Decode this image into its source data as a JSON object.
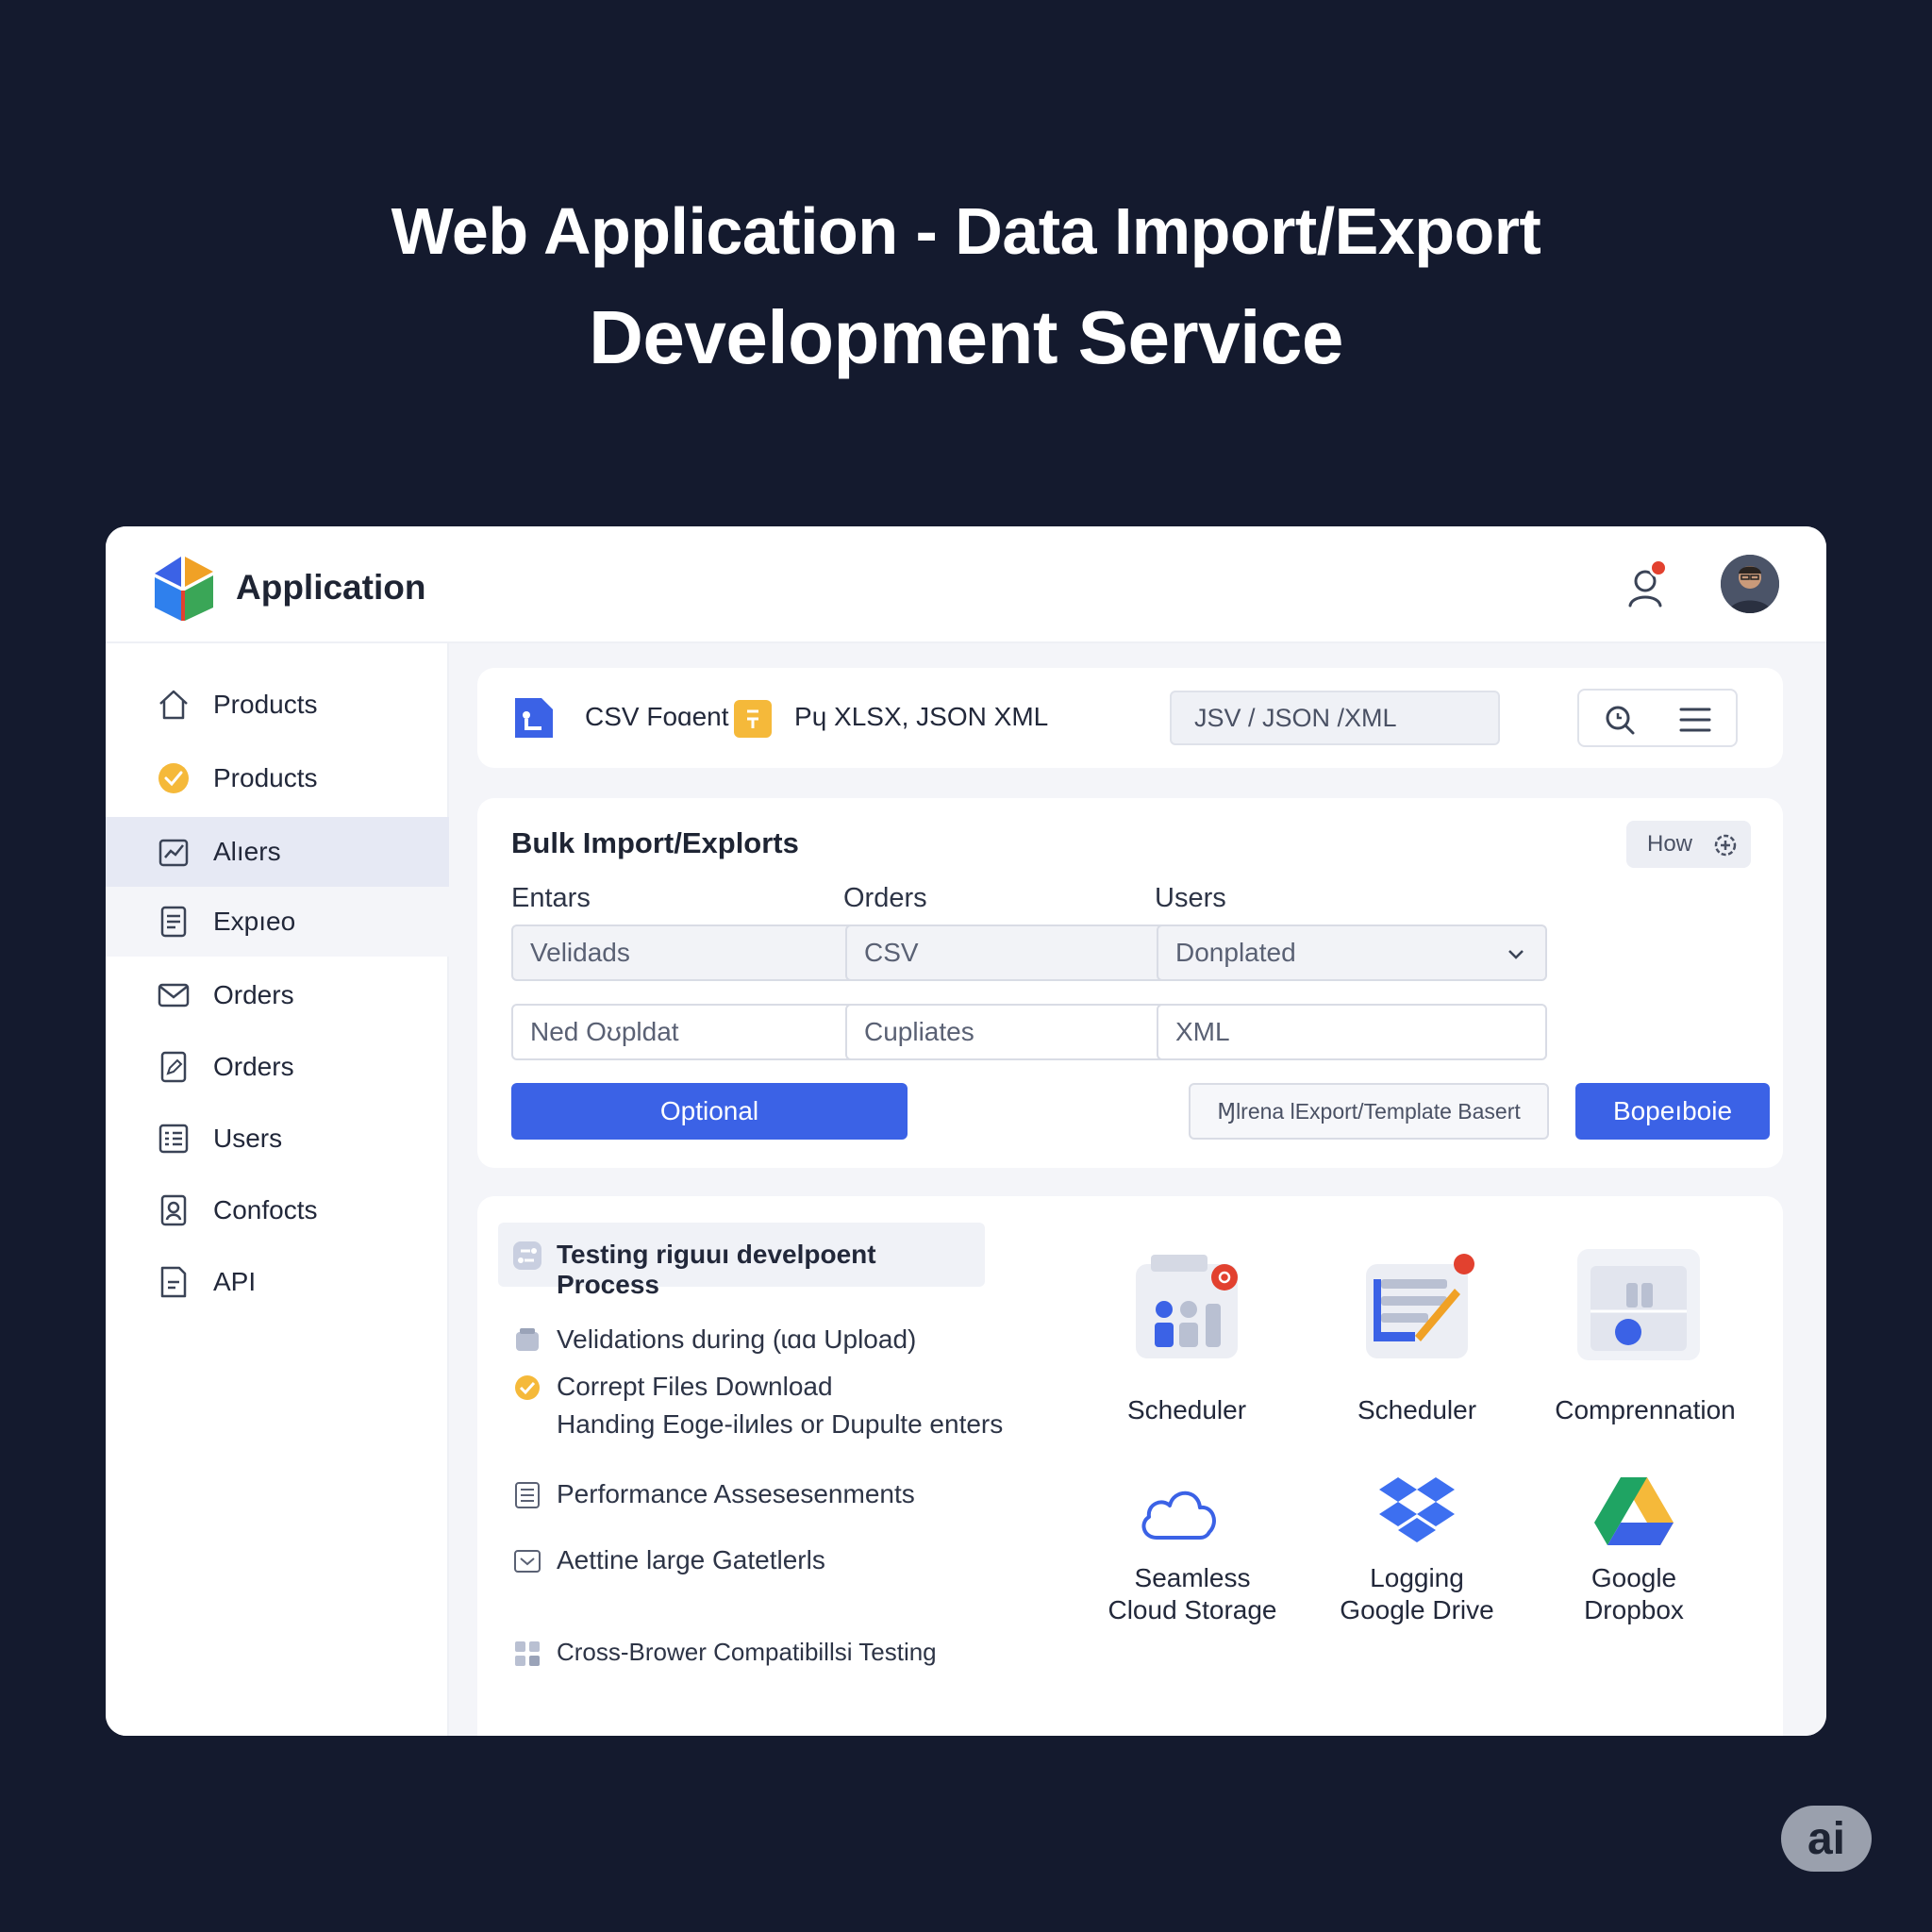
{
  "hero": {
    "line1": "Web Application - Data Import/Export",
    "line2": "Development Service"
  },
  "app": {
    "name": "Application"
  },
  "header": {
    "notification_icon": "user-bell-icon",
    "notification_color": "#e2412f"
  },
  "sidebar": {
    "items": [
      {
        "label": "Products",
        "icon": "home-icon"
      },
      {
        "label": "Products",
        "icon": "check-circle-icon"
      },
      {
        "label": "Alıers",
        "icon": "chart-icon"
      },
      {
        "label": "Expıeo",
        "icon": "document-icon"
      },
      {
        "label": "Orders",
        "icon": "mail-icon"
      },
      {
        "label": "Orders",
        "icon": "file-edit-icon"
      },
      {
        "label": "Users",
        "icon": "list-icon"
      },
      {
        "label": "Confocts",
        "icon": "contacts-icon"
      },
      {
        "label": "API",
        "icon": "api-doc-icon"
      }
    ]
  },
  "toolbar": {
    "csv_label": "CSV Foɑent",
    "formats_label": "Pɥ XLSX, JSON XML",
    "format_input_value": "JSV / JSON /XML"
  },
  "bulk": {
    "title": "Bulk Import/Explorts",
    "how_label": "How",
    "columns": [
      {
        "label": "Entars",
        "select": "Velidads",
        "input": "Ned Oʊpldat"
      },
      {
        "label": "Orders",
        "select": "CSV",
        "input": "Cupliates"
      },
      {
        "label": "Users",
        "select": "Donplated",
        "input": "XML"
      }
    ],
    "optional_button": "Optional",
    "template_button": "Ɱlrena lExport/Template Basert",
    "submit_button": "Bopeıboie",
    "accent": "#3b62e6"
  },
  "testing": {
    "title": "Testing riguuı develpoent Process",
    "rows": [
      "Velidations during (ɩɑɑ Upload)",
      "Corrept Files Download",
      "Handing Eoge-ilиles or Dupulte enters",
      "Performance Assesesenments",
      "Aettine large Gatetlerls",
      "Cross-Brower Compatibillsi Testing"
    ]
  },
  "integrations": {
    "top": [
      "Scheduler",
      "Scheduler",
      "Comprennation"
    ],
    "bottom": [
      {
        "line1": "Seamless",
        "line2": "Cloud Storage"
      },
      {
        "line1": "Logging",
        "line2": "Google Drive"
      },
      {
        "line1": "Google",
        "line2": "Dropbox"
      }
    ]
  },
  "badge": {
    "label": "ai"
  }
}
